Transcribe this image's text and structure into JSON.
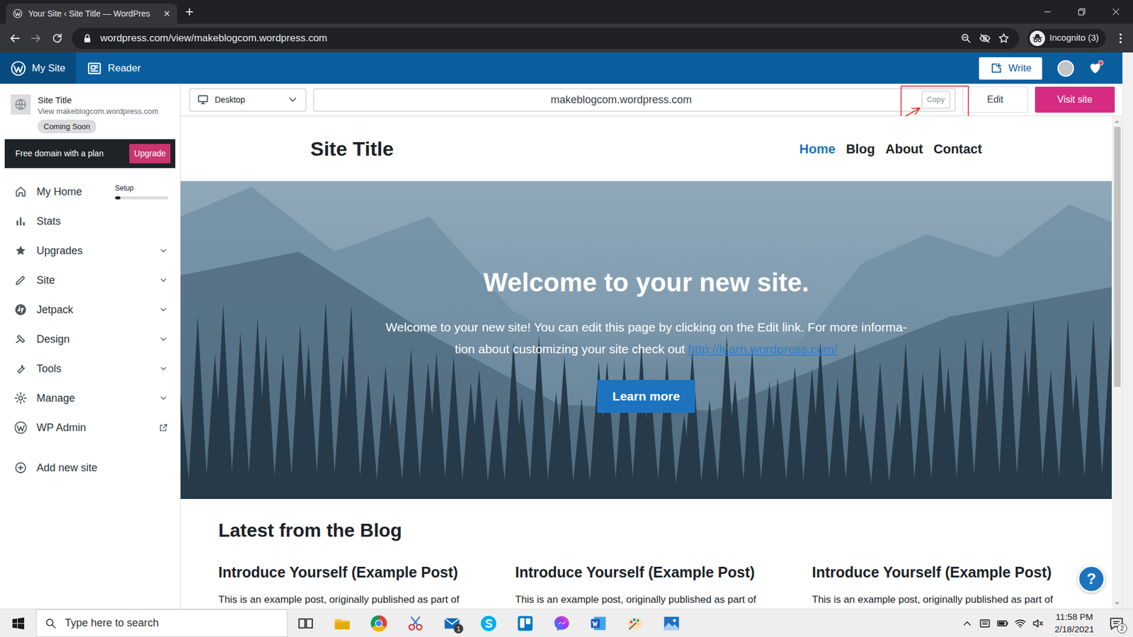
{
  "browser": {
    "tab_title": "Your Site ‹ Site Title — WordPres",
    "tab_close": "×",
    "new_tab": "+",
    "address": "wordpress.com/view/makeblogcom.wordpress.com",
    "profile": "Incognito (3)"
  },
  "masterbar": {
    "items": [
      {
        "label": "My Site",
        "selected": true
      },
      {
        "label": "Reader",
        "selected": false
      }
    ],
    "write": "Write",
    "notifications_unread": true
  },
  "sidebar": {
    "site_title": "Site Title",
    "site_url": "View makeblogcom.wordpress.com",
    "site_badge": "Coming Soon",
    "upsell_text": "Free domain with a plan",
    "upsell_button": "Upgrade",
    "items": [
      {
        "label": "My Home",
        "kind": "progress",
        "progress_label": "Setup",
        "level": 0.1,
        "selected": false
      },
      {
        "label": "Stats",
        "kind": "plain",
        "selected": false
      },
      {
        "label": "Upgrades",
        "kind": "expandable",
        "expanded": false,
        "selected": false
      },
      {
        "label": "Site",
        "kind": "expandable",
        "expanded": false,
        "selected": false
      },
      {
        "label": "Jetpack",
        "kind": "expandable",
        "expanded": false,
        "selected": false
      },
      {
        "label": "Design",
        "kind": "expandable",
        "expanded": false,
        "selected": false
      },
      {
        "label": "Tools",
        "kind": "expandable",
        "expanded": false,
        "selected": false
      },
      {
        "label": "Manage",
        "kind": "expandable",
        "expanded": false,
        "selected": false
      },
      {
        "label": "WP Admin",
        "kind": "external",
        "selected": false
      },
      {
        "label": "Add new site",
        "kind": "add",
        "selected": false
      }
    ]
  },
  "toolbar": {
    "device": "Desktop",
    "url": "makeblogcom.wordpress.com",
    "copy": "Copy",
    "edit": "Edit",
    "visit": "Visit site"
  },
  "preview": {
    "site_title": "Site Title",
    "nav": [
      {
        "label": "Home",
        "selected": true
      },
      {
        "label": "Blog",
        "selected": false
      },
      {
        "label": "About",
        "selected": false
      },
      {
        "label": "Contact",
        "selected": false
      }
    ],
    "hero": {
      "heading": "Welcome to your new site.",
      "lines": [
        "Welcome to your new site! You can edit this page by clicking on the Edit link. For more informa-",
        "tion about customizing your site check out"
      ],
      "link": "http://learn.wordpress.com/",
      "button": "Learn more"
    },
    "blog": {
      "heading": "Latest from the Blog",
      "posts": [
        {
          "title": "Introduce Yourself (Example Post)",
          "excerpt": "This is an example post, originally published as part of"
        },
        {
          "title": "Introduce Yourself (Example Post)",
          "excerpt": "This is an example post, originally published as part of"
        },
        {
          "title": "Introduce Yourself (Example Post)",
          "excerpt": "This is an example post, originally published as part of"
        }
      ]
    }
  },
  "help": "?",
  "taskbar": {
    "search": "Type here to search",
    "mail_badge": "1",
    "time": "11:58 PM",
    "date": "2/18/2021",
    "notifications": "2"
  }
}
